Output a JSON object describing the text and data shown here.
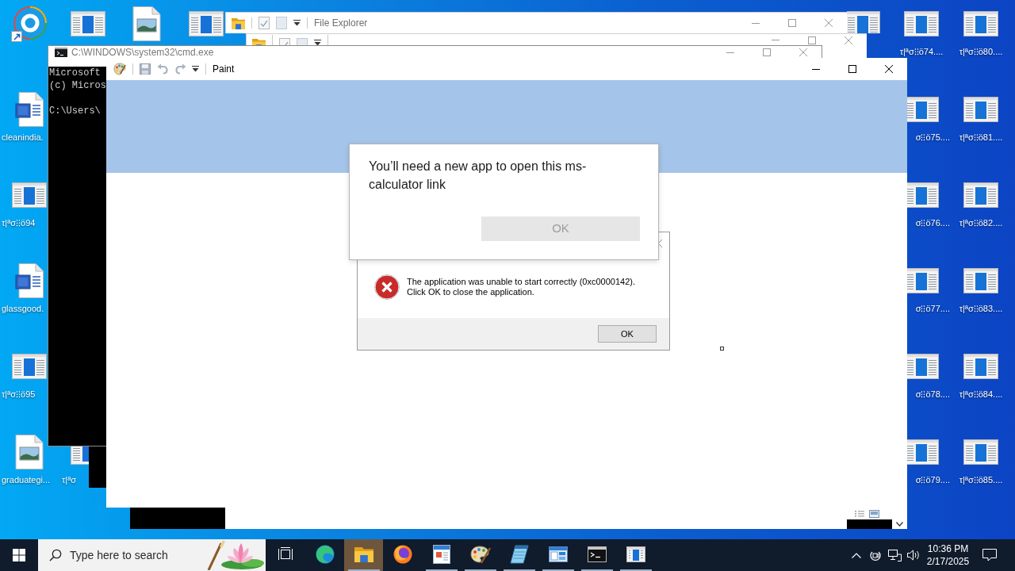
{
  "desktop_icons": [
    {
      "kind": "round-app"
    },
    {
      "kind": "word-doc",
      "label": "cleanindia."
    },
    {
      "kind": "app-window",
      "label": "τ|ªσ⁝⁝ö94"
    },
    {
      "kind": "word-doc",
      "label": "glassgood."
    },
    {
      "kind": "app-window",
      "label": "τ|ªσ⁝⁝ö95"
    },
    {
      "kind": "image-file",
      "label": "graduategi..."
    },
    {
      "kind": "app-window"
    },
    {
      "kind": "app-window",
      "label": "τ|ªσ"
    },
    {
      "kind": "image-file"
    },
    {
      "kind": "app-window"
    },
    {
      "kind": "app-window"
    },
    {
      "kind": "app-window",
      "label": "τ|ªσ⁝⁝ö74...."
    },
    {
      "kind": "app-window",
      "label": "σ⁝⁝ö75...."
    },
    {
      "kind": "app-window",
      "label": "σ⁝⁝ö76...."
    },
    {
      "kind": "app-window",
      "label": "σ⁝⁝ö77...."
    },
    {
      "kind": "app-window",
      "label": "σ⁝⁝ö78...."
    },
    {
      "kind": "app-window",
      "label": "σ⁝⁝ö79...."
    },
    {
      "kind": "app-window",
      "label": "τ|ªσ⁝⁝ö80...."
    },
    {
      "kind": "app-window",
      "label": "τ|ªσ⁝⁝ö81...."
    },
    {
      "kind": "app-window",
      "label": "τ|ªσ⁝⁝ö82...."
    },
    {
      "kind": "app-window",
      "label": "τ|ªσ⁝⁝ö83...."
    },
    {
      "kind": "app-window",
      "label": "τ|ªσ⁝⁝ö84...."
    },
    {
      "kind": "app-window",
      "label": "τ|ªσ⁝⁝ö85...."
    }
  ],
  "explorer_windows": [
    {
      "title": "File Explorer",
      "active": false
    },
    {
      "active": false
    }
  ],
  "console_window": {
    "title": "C:\\WINDOWS\\system32\\cmd.exe",
    "active": false,
    "output_blocks": [
      [
        "Microsoft",
        "(c) Micros"
      ],
      [
        "C:\\Users\\"
      ]
    ]
  },
  "paint_window": {
    "title": "Paint",
    "active": true
  },
  "error_dialog": {
    "message": "The application was unable to start correctly (0xc0000142).\nClick OK to close the application.",
    "button": {
      "label": "OK",
      "disabled": false
    }
  },
  "app_dialog": {
    "message": "You’ll need a new app to open this ms-calculator link",
    "button": {
      "label": "OK",
      "disabled": true
    }
  },
  "taskbar": {
    "search": {
      "placeholder": "Type here to search"
    },
    "apps": [
      {
        "kind": "task-view",
        "running": false,
        "selected": false
      },
      {
        "kind": "swirl-browser",
        "running": false,
        "selected": false
      },
      {
        "kind": "folder",
        "running": true,
        "selected": true
      },
      {
        "kind": "fox-browser",
        "running": false,
        "selected": false
      },
      {
        "kind": "document",
        "running": true,
        "selected": false
      },
      {
        "kind": "palette",
        "running": true,
        "selected": false
      },
      {
        "kind": "notepad",
        "running": true,
        "selected": false
      },
      {
        "kind": "app-window",
        "running": true,
        "selected": false
      },
      {
        "kind": "console",
        "running": true,
        "selected": false
      },
      {
        "kind": "window",
        "running": true,
        "selected": false
      }
    ],
    "clock": {
      "time": "10:36 PM",
      "date": "2/17/2025"
    }
  }
}
